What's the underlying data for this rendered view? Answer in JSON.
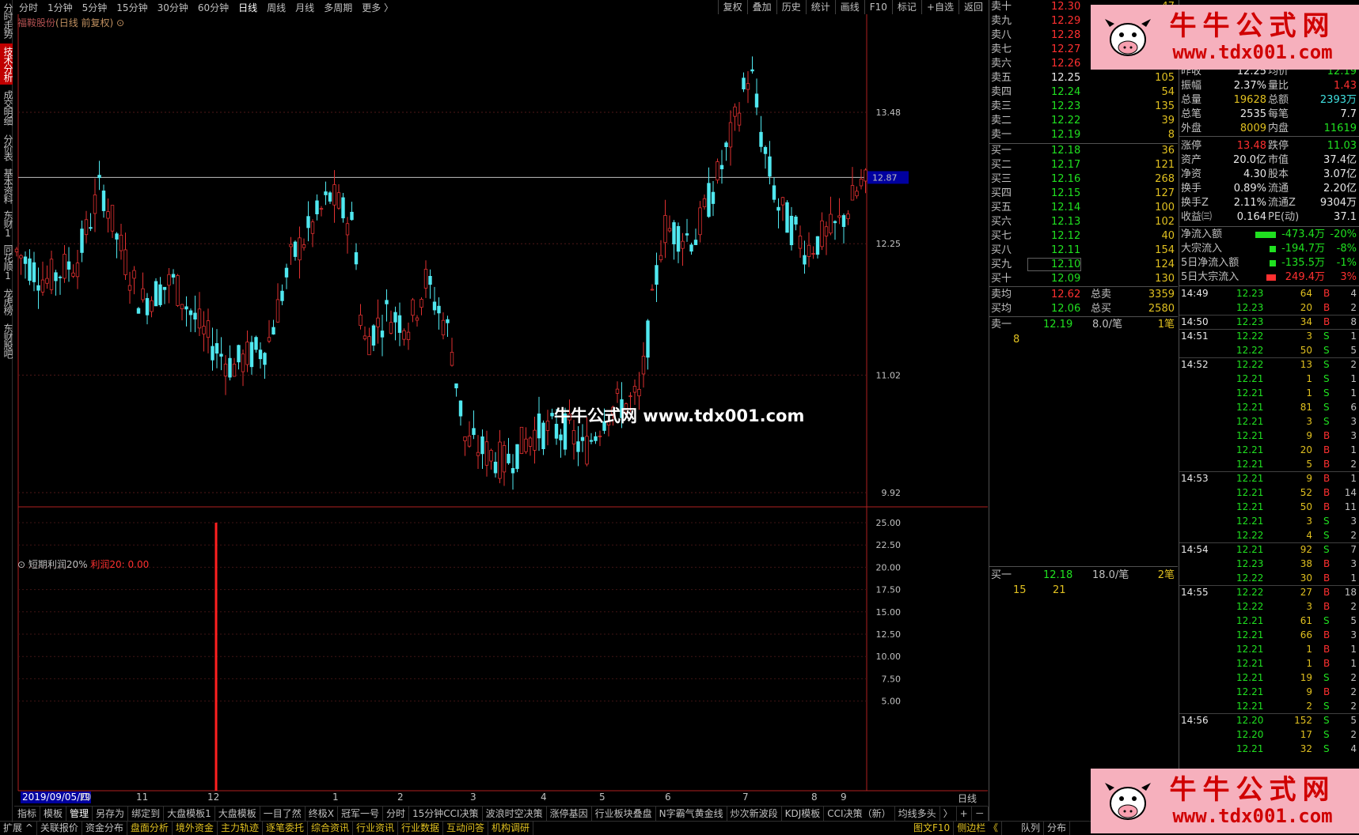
{
  "top_periods": [
    "分时",
    "1分钟",
    "5分钟",
    "15分钟",
    "30分钟",
    "60分钟",
    "日线",
    "周线",
    "月线",
    "多周期",
    "更多 〉"
  ],
  "top_selected": "日线",
  "top_tools": [
    "复权",
    "叠加",
    "历史",
    "统计",
    "画线",
    "F10",
    "标记",
    "+自选",
    "返回"
  ],
  "left_sidebar": [
    "分时走势",
    "技术分析",
    "成交明细",
    "分价表",
    "基本资料",
    "东财10",
    "同花顺10",
    "龙虎榜",
    "东财股吧"
  ],
  "left_selected": "技术分析",
  "stock_title": {
    "name": "福鞍股份",
    "mode": "(日线 前复权)"
  },
  "price_axis": [
    "13.48",
    "12.25",
    "11.02",
    "9.92"
  ],
  "crosshair_price": "12.87",
  "indicator_axis": [
    "25.00",
    "22.50",
    "20.00",
    "17.50",
    "15.00",
    "12.50",
    "10.00",
    "7.50",
    "5.00"
  ],
  "indicator": {
    "name": "短期利润20%",
    "label": "利润20: 0.00"
  },
  "watermark": "牛牛公式网 www.tdx001.com",
  "x_date_box": "2019/09/05/四",
  "x_axis": [
    "2",
    "10",
    "11",
    "12",
    "1",
    "2",
    "3",
    "4",
    "5",
    "6",
    "7",
    "8",
    "9"
  ],
  "period_label": "日线",
  "tabs": [
    "指标",
    "模板",
    "管理",
    "另存为",
    "绑定到",
    "大盘模板1",
    "大盘模板",
    "一目了然",
    "终极X",
    "冠军一号",
    "分时",
    "15分钟CCI决策",
    "波浪时空决策",
    "涨停基因",
    "行业板块叠盘",
    "N字霸气黄金线",
    "炒次新波段",
    "KDJ模板",
    "CCI决策（新）",
    "均线多头",
    "〉"
  ],
  "tabs_selected": "管理",
  "tab_right": [
    "+",
    "－"
  ],
  "bottom_bar": [
    "扩展 ^",
    "关联报价",
    "资金分布",
    "盘面分析",
    "境外资金",
    "主力轨迹",
    "逐笔委托",
    "综合资讯",
    "行业资讯",
    "行业数据",
    "互动问答",
    "机构调研"
  ],
  "bottom_right": [
    "图文F10",
    "侧边栏 《",
    "队列",
    "分布"
  ],
  "sells": [
    {
      "label": "卖十",
      "price": "12.30",
      "vol": "47"
    },
    {
      "label": "卖九",
      "price": "12.29",
      "vol": ""
    },
    {
      "label": "卖八",
      "price": "12.28",
      "vol": ""
    },
    {
      "label": "卖七",
      "price": "12.27",
      "vol": ""
    },
    {
      "label": "卖六",
      "price": "12.26",
      "vol": ""
    },
    {
      "label": "卖五",
      "price": "12.25",
      "vol": "105"
    },
    {
      "label": "卖四",
      "price": "12.24",
      "vol": "54"
    },
    {
      "label": "卖三",
      "price": "12.23",
      "vol": "135"
    },
    {
      "label": "卖二",
      "price": "12.22",
      "vol": "39"
    },
    {
      "label": "卖一",
      "price": "12.19",
      "vol": "8"
    }
  ],
  "buys": [
    {
      "label": "买一",
      "price": "12.18",
      "vol": "36"
    },
    {
      "label": "买二",
      "price": "12.17",
      "vol": "121"
    },
    {
      "label": "买三",
      "price": "12.16",
      "vol": "268"
    },
    {
      "label": "买四",
      "price": "12.15",
      "vol": "127"
    },
    {
      "label": "买五",
      "price": "12.14",
      "vol": "100"
    },
    {
      "label": "买六",
      "price": "12.13",
      "vol": "102"
    },
    {
      "label": "买七",
      "price": "12.12",
      "vol": "40"
    },
    {
      "label": "买八",
      "price": "12.11",
      "vol": "154"
    },
    {
      "label": "买九",
      "price": "12.10",
      "vol": "124"
    },
    {
      "label": "买十",
      "price": "12.09",
      "vol": "130"
    }
  ],
  "avg": [
    {
      "label": "卖均",
      "price": "12.62",
      "label2": "总卖",
      "vol": "3359"
    },
    {
      "label": "买均",
      "price": "12.06",
      "label2": "总买",
      "vol": "2580"
    }
  ],
  "queue_sell": {
    "label": "卖一",
    "price": "12.19",
    "per": "8.0/笔",
    "count": "1笔",
    "items": [
      "8"
    ]
  },
  "queue_buy": {
    "label": "买一",
    "price": "12.18",
    "per": "18.0/笔",
    "count": "2笔",
    "items": [
      "15",
      "21"
    ]
  },
  "stats": [
    {
      "l1": "昨收",
      "v1": "12.25",
      "l2": "均价",
      "v2": "12.19"
    },
    {
      "l1": "振幅",
      "v1": "2.37%",
      "l2": "量比",
      "v2": "1.43"
    },
    {
      "l1": "总量",
      "v1": "19628",
      "l2": "总额",
      "v2": "2393万"
    },
    {
      "l1": "总笔",
      "v1": "2535",
      "l2": "每笔",
      "v2": "7.7"
    },
    {
      "l1": "外盘",
      "v1": "8009",
      "l2": "内盘",
      "v2": "11619"
    },
    {
      "l1": "涨停",
      "v1": "13.48",
      "l2": "跌停",
      "v2": "11.03"
    },
    {
      "l1": "资产",
      "v1": "20.0亿",
      "l2": "市值",
      "v2": "37.4亿"
    },
    {
      "l1": "净资",
      "v1": "4.30",
      "l2": "股本",
      "v2": "3.07亿"
    },
    {
      "l1": "换手",
      "v1": "0.89%",
      "l2": "流通",
      "v2": "2.20亿"
    },
    {
      "l1": "换手Z",
      "v1": "2.11%",
      "l2": "流通Z",
      "v2": "9304万"
    },
    {
      "l1": "收益㈢",
      "v1": "0.164",
      "l2": "PE(动)",
      "v2": "37.1"
    }
  ],
  "flows": [
    {
      "label": "净流入额",
      "value": "-473.4万",
      "pct": "-20%",
      "color": "#20e020"
    },
    {
      "label": "大宗流入",
      "value": "-194.7万",
      "pct": "-8%",
      "color": "#20e020"
    },
    {
      "label": "5日净流入额",
      "value": "-135.5万",
      "pct": "-1%",
      "color": "#20e020"
    },
    {
      "label": "5日大宗流入",
      "value": "249.4万",
      "pct": "3%",
      "color": "#ff3030"
    }
  ],
  "ticks": [
    {
      "t": "14:49",
      "p": "12.23",
      "v": "64",
      "bs": "B",
      "n": "4"
    },
    {
      "t": "",
      "p": "12.23",
      "v": "20",
      "bs": "B",
      "n": "2"
    },
    {
      "t": "14:50",
      "p": "12.23",
      "v": "34",
      "bs": "B",
      "n": "8"
    },
    {
      "t": "14:51",
      "p": "12.22",
      "v": "3",
      "bs": "S",
      "n": "1"
    },
    {
      "t": "",
      "p": "12.22",
      "v": "50",
      "bs": "S",
      "n": "5"
    },
    {
      "t": "14:52",
      "p": "12.22",
      "v": "13",
      "bs": "S",
      "n": "2"
    },
    {
      "t": "",
      "p": "12.21",
      "v": "1",
      "bs": "S",
      "n": "1"
    },
    {
      "t": "",
      "p": "12.21",
      "v": "1",
      "bs": "S",
      "n": "1"
    },
    {
      "t": "",
      "p": "12.21",
      "v": "81",
      "bs": "S",
      "n": "6"
    },
    {
      "t": "",
      "p": "12.21",
      "v": "3",
      "bs": "S",
      "n": "3"
    },
    {
      "t": "",
      "p": "12.21",
      "v": "9",
      "bs": "B",
      "n": "3"
    },
    {
      "t": "",
      "p": "12.21",
      "v": "20",
      "bs": "B",
      "n": "1"
    },
    {
      "t": "",
      "p": "12.21",
      "v": "5",
      "bs": "B",
      "n": "2"
    },
    {
      "t": "14:53",
      "p": "12.21",
      "v": "9",
      "bs": "B",
      "n": "1"
    },
    {
      "t": "",
      "p": "12.21",
      "v": "52",
      "bs": "B",
      "n": "14"
    },
    {
      "t": "",
      "p": "12.21",
      "v": "50",
      "bs": "B",
      "n": "11"
    },
    {
      "t": "",
      "p": "12.21",
      "v": "3",
      "bs": "S",
      "n": "3"
    },
    {
      "t": "",
      "p": "12.22",
      "v": "4",
      "bs": "S",
      "n": "2"
    },
    {
      "t": "14:54",
      "p": "12.21",
      "v": "92",
      "bs": "S",
      "n": "7"
    },
    {
      "t": "",
      "p": "12.23",
      "v": "38",
      "bs": "B",
      "n": "3"
    },
    {
      "t": "",
      "p": "12.22",
      "v": "30",
      "bs": "B",
      "n": "1"
    },
    {
      "t": "14:55",
      "p": "12.22",
      "v": "27",
      "bs": "B",
      "n": "18"
    },
    {
      "t": "",
      "p": "12.22",
      "v": "3",
      "bs": "B",
      "n": "2"
    },
    {
      "t": "",
      "p": "12.21",
      "v": "61",
      "bs": "S",
      "n": "5"
    },
    {
      "t": "",
      "p": "12.21",
      "v": "66",
      "bs": "B",
      "n": "3"
    },
    {
      "t": "",
      "p": "12.21",
      "v": "1",
      "bs": "B",
      "n": "1"
    },
    {
      "t": "",
      "p": "12.21",
      "v": "1",
      "bs": "B",
      "n": "1"
    },
    {
      "t": "",
      "p": "12.21",
      "v": "19",
      "bs": "S",
      "n": "2"
    },
    {
      "t": "",
      "p": "12.21",
      "v": "9",
      "bs": "B",
      "n": "2"
    },
    {
      "t": "",
      "p": "12.21",
      "v": "2",
      "bs": "S",
      "n": "2"
    },
    {
      "t": "14:56",
      "p": "12.20",
      "v": "152",
      "bs": "S",
      "n": "5"
    },
    {
      "t": "",
      "p": "12.20",
      "v": "17",
      "bs": "S",
      "n": "2"
    },
    {
      "t": "",
      "p": "12.21",
      "v": "32",
      "bs": "S",
      "n": "4"
    }
  ],
  "logo": {
    "title": "牛牛公式网",
    "url": "www.tdx001.com"
  },
  "colors": {
    "up": "#e03030",
    "down": "#50e8f0",
    "indicator_bar": "#ff2020",
    "accent_select": "#c00000"
  },
  "chart_data": {
    "type": "candlestick",
    "y_axis_ticks": [
      13.48,
      12.25,
      11.02,
      9.92
    ],
    "crosshair": 12.87,
    "indicator": {
      "name": "短期利润20%",
      "type": "bar",
      "ylim": [
        0,
        25
      ],
      "signal_value": 25
    }
  }
}
